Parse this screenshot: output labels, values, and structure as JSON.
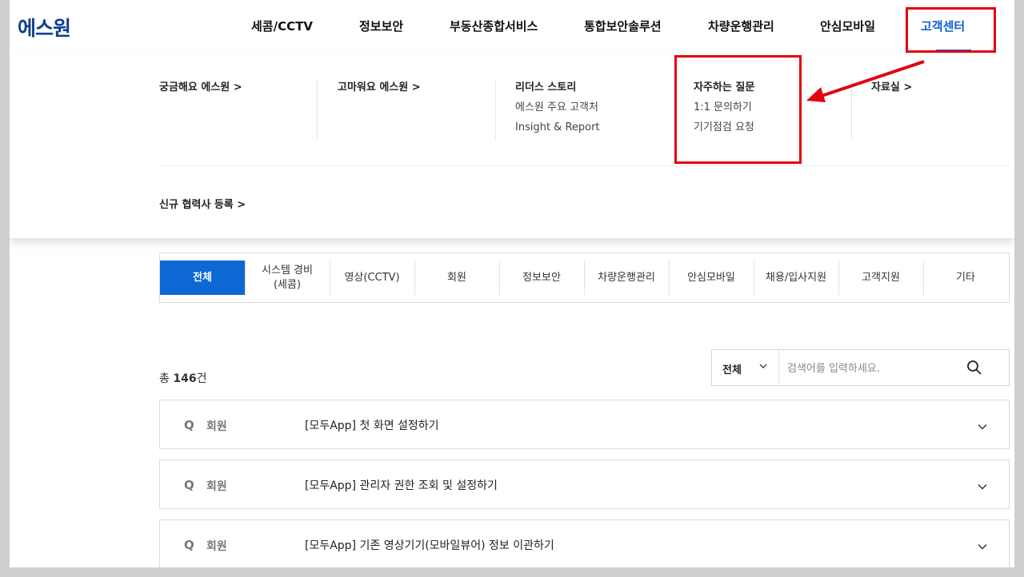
{
  "header": {
    "logo": "에스원",
    "nav": [
      "세콤/CCTV",
      "정보보안",
      "부동산종합서비스",
      "통합보안솔루션",
      "차량운행관리",
      "안심모바일",
      "고객센터"
    ],
    "active_nav": "고객센터"
  },
  "mega_menu": {
    "col1": [
      "궁금해요 에스원 >"
    ],
    "col2": [
      "고마워요 에스원 >"
    ],
    "col3": [
      "리더스 스토리",
      "에스원 주요 고객처",
      "Insight & Report"
    ],
    "col4": [
      "자주하는 질문",
      "1:1 문의하기",
      "기기점검 요청"
    ],
    "col5": [
      "자료실 >"
    ],
    "row2": "신규 협력사 등록 >"
  },
  "tabs": [
    "전체",
    "시스템 경비\n(세콤)",
    "영상(CCTV)",
    "회원",
    "정보보안",
    "차량운행관리",
    "안심모바일",
    "채용/입사지원",
    "고객지원",
    "기타"
  ],
  "active_tab": "전체",
  "total": {
    "prefix": "총 ",
    "count": "146",
    "suffix": "건"
  },
  "search": {
    "select_value": "전체",
    "placeholder": "검색어를 입력하세요."
  },
  "faq_items": [
    {
      "q": "Q",
      "category": "회원",
      "title": "[모두App] 첫 화면 설정하기"
    },
    {
      "q": "Q",
      "category": "회원",
      "title": "[모두App] 관리자 권한 조회 및 설정하기"
    },
    {
      "q": "Q",
      "category": "회원",
      "title": "[모두App] 기존 영상기기(모바일뷰어) 정보 이관하기"
    }
  ],
  "icons": {
    "search": "search-icon",
    "select_chevron": "chevron-down-icon",
    "faq_chevron": "chevron-down-icon",
    "annotation_arrow": "arrow-icon"
  },
  "colors": {
    "brand": "#0f3f91",
    "accent": "#0d68d3",
    "annotation": "#e3000f"
  }
}
